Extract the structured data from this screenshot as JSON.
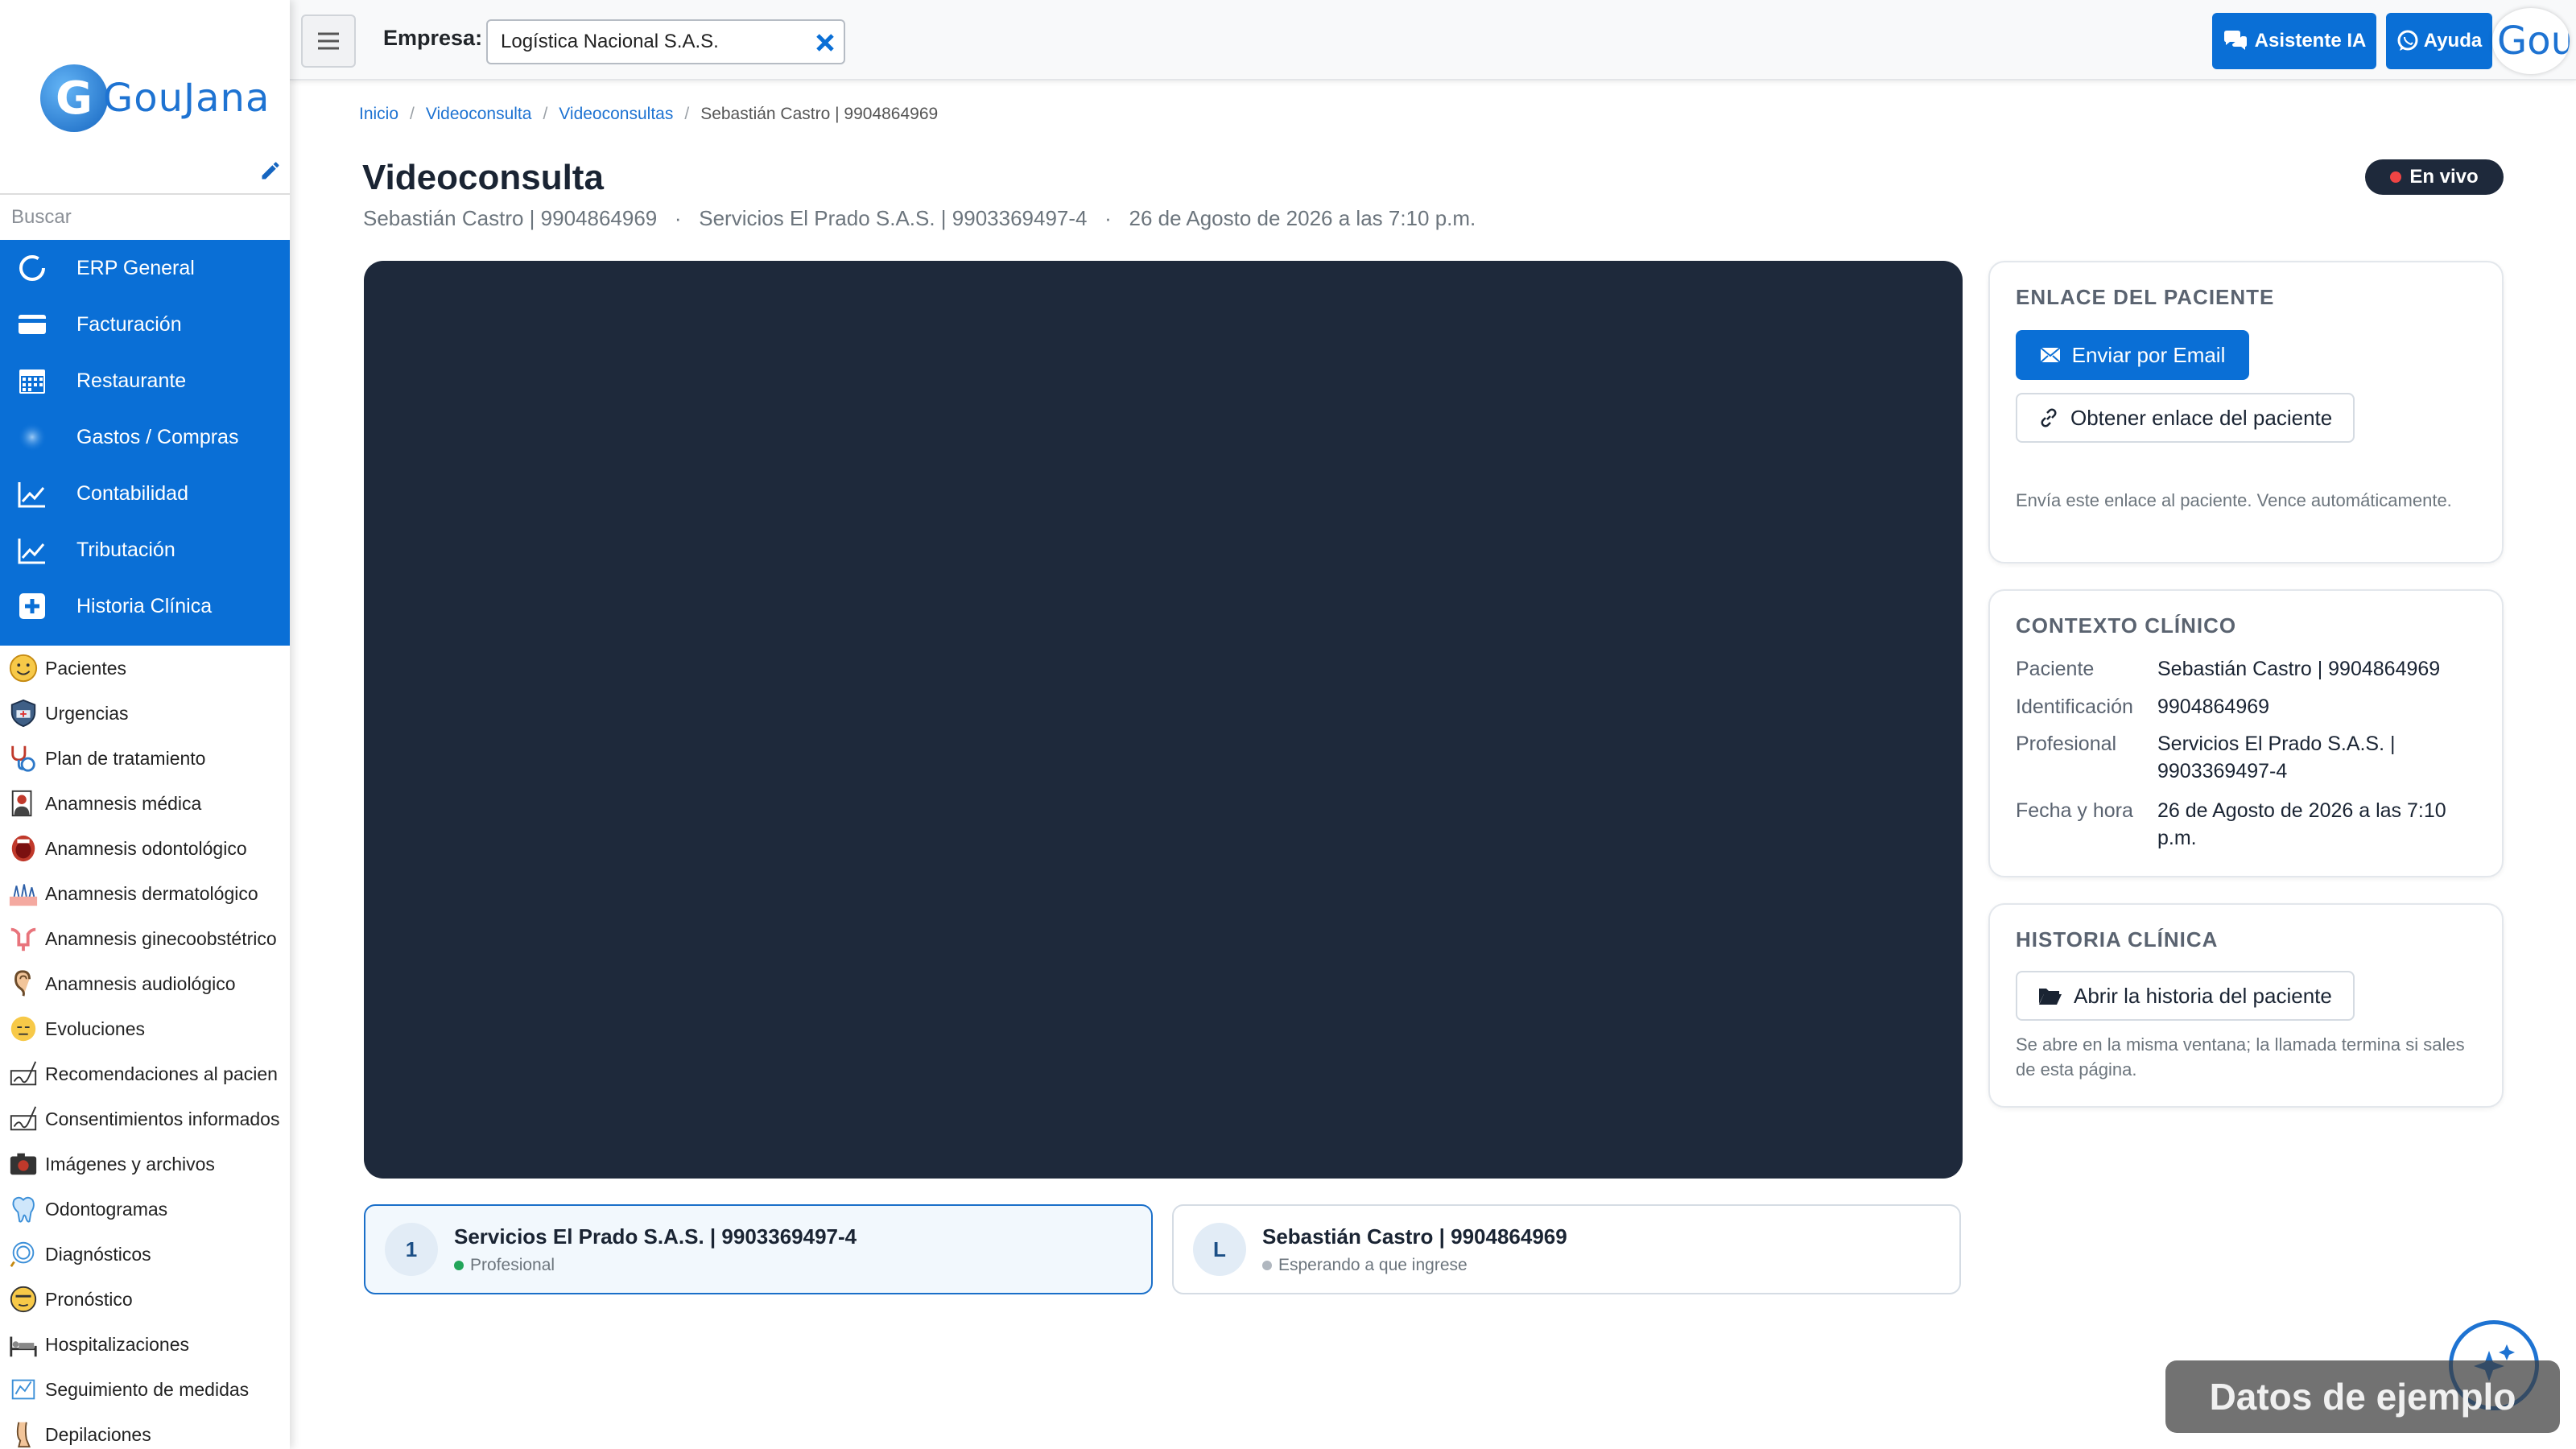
{
  "sidebar": {
    "logo_letter": "G",
    "logo_text": "GouJana",
    "search_placeholder": "Buscar",
    "modules": [
      {
        "label": "ERP General",
        "icon": "circle-icon"
      },
      {
        "label": "Facturación",
        "icon": "card-icon"
      },
      {
        "label": "Restaurante",
        "icon": "calendar-icon"
      },
      {
        "label": "Gastos / Compras",
        "icon": "blob-icon"
      },
      {
        "label": "Contabilidad",
        "icon": "chart-icon"
      },
      {
        "label": "Tributación",
        "icon": "chart-icon"
      },
      {
        "label": "Historia Clínica",
        "icon": "plus-icon"
      }
    ],
    "subitems": [
      {
        "label": "Pacientes",
        "icon": "smiley-icon"
      },
      {
        "label": "Urgencias",
        "icon": "ambulance-icon"
      },
      {
        "label": "Plan de tratamiento",
        "icon": "stethoscope-icon"
      },
      {
        "label": "Anamnesis médica",
        "icon": "doctor-icon"
      },
      {
        "label": "Anamnesis odontológico",
        "icon": "mouth-icon"
      },
      {
        "label": "Anamnesis dermatológico",
        "icon": "skin-icon"
      },
      {
        "label": "Anamnesis ginecoobstétrico",
        "icon": "uterus-icon"
      },
      {
        "label": "Anamnesis audiológico",
        "icon": "ear-icon"
      },
      {
        "label": "Evoluciones",
        "icon": "face-icon"
      },
      {
        "label": "Recomendaciones al pacien",
        "icon": "signature-icon"
      },
      {
        "label": "Consentimientos informados",
        "icon": "signature-icon"
      },
      {
        "label": "Imágenes y archivos",
        "icon": "camera-icon"
      },
      {
        "label": "Odontogramas",
        "icon": "tooth-icon"
      },
      {
        "label": "Diagnósticos",
        "icon": "stethoscope-icon"
      },
      {
        "label": "Pronóstico",
        "icon": "emoji-icon"
      },
      {
        "label": "Hospitalizaciones",
        "icon": "bed-icon"
      },
      {
        "label": "Seguimiento de medidas",
        "icon": "scale-icon"
      },
      {
        "label": "Depilaciones",
        "icon": "leg-icon"
      }
    ]
  },
  "topbar": {
    "empresa_label": "Empresa:",
    "empresa_value": "Logística Nacional S.A.S.",
    "assistant_label": "Asistente IA",
    "help_label": "Ayuda",
    "avatar_text": "Gou"
  },
  "breadcrumb": [
    "Inicio",
    "Videoconsulta",
    "Videoconsultas",
    "Sebastián Castro | 9904864969"
  ],
  "page": {
    "title": "Videoconsulta",
    "subtitle": "Sebastián Castro | 9904864969   ·   Servicios El Prado S.A.S. | 9903369497-4   ·   26 de Agosto de 2026 a las 7:10 p.m.",
    "live_label": "En vivo",
    "live_color": "#ef4444"
  },
  "participants": [
    {
      "initial": "1",
      "name": "Servicios El Prado S.A.S. | 9903369497-4",
      "status": "Profesional",
      "status_color": "#22a55a"
    },
    {
      "initial": "L",
      "name": "Sebastián Castro | 9904864969",
      "status": "Esperando a que ingrese",
      "status_color": "#b0b7bf"
    }
  ],
  "link_card": {
    "title": "ENLACE DEL PACIENTE",
    "email_button": "Enviar por Email",
    "get_link_button": "Obtener enlace del paciente",
    "hint": "Envía este enlace al paciente. Vence automáticamente."
  },
  "context_card": {
    "title": "CONTEXTO CLÍNICO",
    "rows": [
      {
        "key": "Paciente",
        "value": "Sebastián Castro | 9904864969"
      },
      {
        "key": "Identificación",
        "value": "9904864969"
      },
      {
        "key": "Profesional",
        "value": "Servicios El Prado S.A.S. | 9903369497-4"
      },
      {
        "key": "Fecha y hora",
        "value": "26 de Agosto de 2026 a las 7:10 p.m."
      }
    ]
  },
  "history_card": {
    "title": "HISTORIA CLÍNICA",
    "open_button": "Abrir la historia del paciente",
    "hint": "Se abre en la misma ventana; la llamada termina si sales de esta página."
  },
  "watermark": "Datos de ejemplo",
  "colors": {
    "primary": "#0a6fd6",
    "video_bg": "#1e293b",
    "live_bg": "#1e293b"
  }
}
